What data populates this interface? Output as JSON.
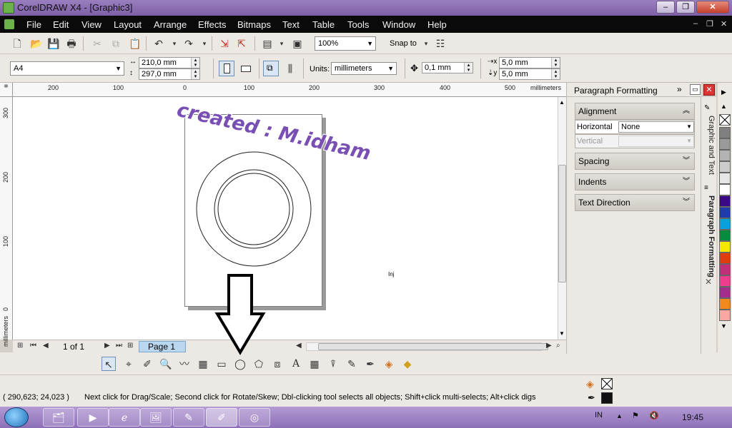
{
  "window": {
    "title": "CorelDRAW X4 - [Graphic3]",
    "controls": {
      "minimize": "–",
      "restore": "❐",
      "close": "✕"
    }
  },
  "menubar": {
    "items": [
      "File",
      "Edit",
      "View",
      "Layout",
      "Arrange",
      "Effects",
      "Bitmaps",
      "Text",
      "Table",
      "Tools",
      "Window",
      "Help"
    ],
    "mdi_controls": [
      "–",
      "❐",
      "✕"
    ]
  },
  "standard_toolbar": {
    "zoom_value": "100%",
    "snap_label": "Snap to"
  },
  "property_bar": {
    "page_size": "A4",
    "width_value": "210,0 mm",
    "height_value": "297,0 mm",
    "units_label": "Units:",
    "units_value": "millimeters",
    "nudge_value": "0,1 mm",
    "dup_x_value": "5,0 mm",
    "dup_y_value": "5,0 mm"
  },
  "ruler": {
    "h_ticks": [
      "200",
      "100",
      "0",
      "100",
      "200",
      "300",
      "400",
      "500"
    ],
    "h_unit": "millimeters",
    "v_ticks": [
      "300",
      "200",
      "100",
      "0"
    ],
    "v_unit": "millimeters"
  },
  "canvas": {
    "watermark_text": "created : M.idham",
    "small_text": "Inj"
  },
  "page_nav": {
    "counter": "1 of 1",
    "page_tab": "Page 1"
  },
  "docker": {
    "title": "Paragraph Formatting",
    "sections": {
      "alignment": "Alignment",
      "horizontal_label": "Horizontal",
      "horizontal_value": "None",
      "vertical_label": "Vertical",
      "spacing": "Spacing",
      "indents": "Indents",
      "text_direction": "Text Direction"
    }
  },
  "side_tabs": {
    "tab1": "Graphic and Text",
    "tab2": "Paragraph Formatting"
  },
  "palette": {
    "colors": [
      "#808080",
      "#9a9a9a",
      "#b3b3b3",
      "#cccccc",
      "#e6e6e6",
      "#ffffff",
      "#3b0a83",
      "#1f3da8",
      "#0aa0d8",
      "#0a8a3c",
      "#f5e800",
      "#e03b12",
      "#c0307a",
      "#ee3d8c",
      "#a0308c",
      "#f08a1e",
      "#f7a8a0"
    ]
  },
  "status": {
    "coordinates": "( 290,623; 24,023 )",
    "hint": "Next click for Drag/Scale; Second click for Rotate/Skew; Dbl-clicking tool selects all objects; Shift+click multi-selects; Alt+click digs"
  },
  "taskbar": {
    "language": "IN",
    "time": "19:45"
  }
}
